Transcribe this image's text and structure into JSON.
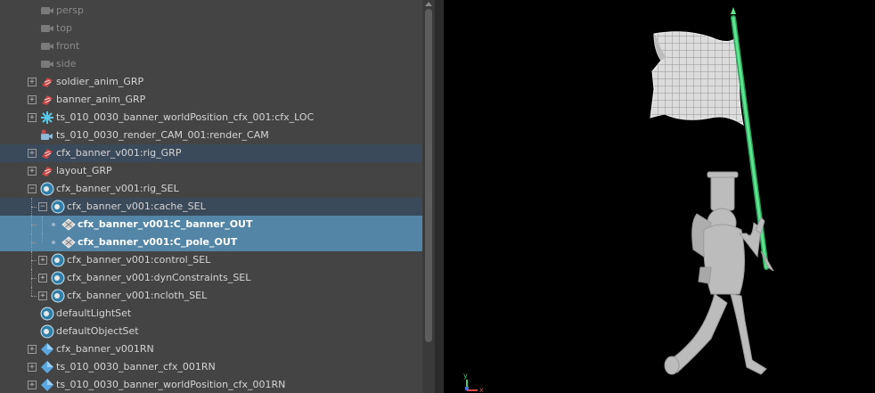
{
  "outliner": {
    "rows": [
      {
        "label": "persp",
        "icon": "camera-icon",
        "dim": true
      },
      {
        "label": "top",
        "icon": "camera-icon",
        "dim": true
      },
      {
        "label": "front",
        "icon": "camera-icon",
        "dim": true
      },
      {
        "label": "side",
        "icon": "camera-icon",
        "dim": true
      },
      {
        "label": "soldier_anim_GRP",
        "icon": "group-icon",
        "expander": "plus"
      },
      {
        "label": "banner_anim_GRP",
        "icon": "group-icon",
        "expander": "plus"
      },
      {
        "label": "ts_010_0030_banner_worldPosition_cfx_001:cfx_LOC",
        "icon": "locator-icon",
        "expander": "plus"
      },
      {
        "label": "ts_010_0030_render_CAM_001:render_CAM",
        "icon": "camera-group-icon"
      },
      {
        "label": "cfx_banner_v001:rig_GRP",
        "icon": "group-icon",
        "expander": "plus",
        "state": "highlighted"
      },
      {
        "label": "layout_GRP",
        "icon": "group-icon",
        "expander": "plus"
      },
      {
        "label": "cfx_banner_v001:rig_SEL",
        "icon": "set-icon",
        "expander": "minus"
      },
      {
        "label": "cfx_banner_v001:cache_SEL",
        "icon": "set-icon",
        "expander": "minus",
        "state": "highlighted"
      },
      {
        "label": "cfx_banner_v001:C_banner_OUT",
        "icon": "mesh-icon",
        "state": "selected"
      },
      {
        "label": "cfx_banner_v001:C_pole_OUT",
        "icon": "mesh-icon",
        "state": "selected"
      },
      {
        "label": "cfx_banner_v001:control_SEL",
        "icon": "set-icon",
        "expander": "plus"
      },
      {
        "label": "cfx_banner_v001:dynConstraints_SEL",
        "icon": "set-icon",
        "expander": "plus"
      },
      {
        "label": "cfx_banner_v001:ncloth_SEL",
        "icon": "set-icon",
        "expander": "plus"
      },
      {
        "label": "defaultLightSet",
        "icon": "set-icon"
      },
      {
        "label": "defaultObjectSet",
        "icon": "set-icon"
      },
      {
        "label": "cfx_banner_v001RN",
        "icon": "reference-icon",
        "expander": "plus"
      },
      {
        "label": "ts_010_0030_banner_cfx_001RN",
        "icon": "reference-icon",
        "expander": "plus"
      },
      {
        "label": "ts_010_0030_banner_worldPosition_cfx_001RN",
        "icon": "reference-icon",
        "expander": "plus"
      }
    ]
  },
  "viewport": {
    "axis_labels": {
      "y": "y",
      "x": "x"
    }
  },
  "colors": {
    "panel_bg": "#444444",
    "highlight": "#3b4a5a",
    "selection": "#5285a6",
    "pole": "#5ee68e",
    "mesh": "#dcdcdc"
  }
}
